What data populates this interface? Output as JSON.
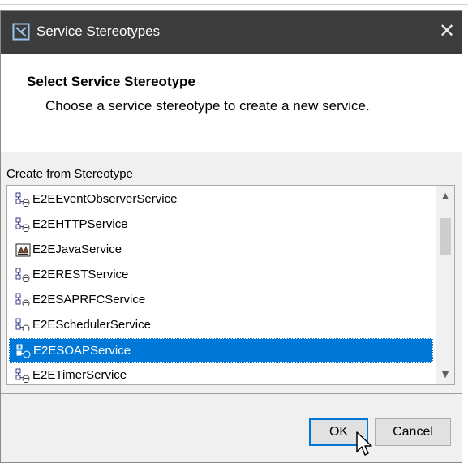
{
  "dialog": {
    "title": "Service Stereotypes",
    "close_glyph": "✕"
  },
  "header": {
    "title": "Select Service Stereotype",
    "description": "Choose a service stereotype to create a new service."
  },
  "list": {
    "label": "Create from Stereotype",
    "items": [
      {
        "label": "E2EEventObserverService",
        "icon": "service-stereotype-icon",
        "selected": false
      },
      {
        "label": "E2EHTTPService",
        "icon": "service-stereotype-icon",
        "selected": false
      },
      {
        "label": "E2EJavaService",
        "icon": "java-service-icon",
        "selected": false
      },
      {
        "label": "E2ERESTService",
        "icon": "service-stereotype-icon",
        "selected": false
      },
      {
        "label": "E2ESAPRFCService",
        "icon": "service-stereotype-icon",
        "selected": false
      },
      {
        "label": "E2ESchedulerService",
        "icon": "service-stereotype-icon",
        "selected": false
      },
      {
        "label": "E2ESOAPService",
        "icon": "soap-service-icon",
        "selected": true
      },
      {
        "label": "E2ETimerService",
        "icon": "service-stereotype-icon",
        "selected": false
      }
    ],
    "scroll_up_glyph": "▲",
    "scroll_down_glyph": "▼"
  },
  "buttons": {
    "ok": "OK",
    "cancel": "Cancel"
  },
  "colors": {
    "title_bar": "#3c3c3c",
    "selection": "#0078d7",
    "dialog_bg": "#f0f0f0"
  }
}
